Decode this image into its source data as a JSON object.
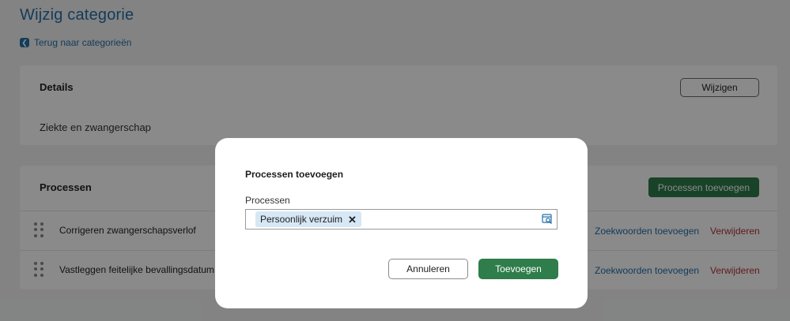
{
  "page": {
    "title": "Wijzig categorie",
    "back_link": "Terug naar categorieën"
  },
  "details": {
    "title": "Details",
    "edit_button": "Wijzigen",
    "value": "Ziekte en zwangerschap"
  },
  "processes": {
    "title": "Processen",
    "add_button": "Processen toevoegen",
    "rows": [
      {
        "label": "Corrigeren zwangerschapsverlof",
        "keywords_link": "Zoekwoorden toevoegen",
        "delete_link": "Verwijderen"
      },
      {
        "label": "Vastleggen feitelijke bevallingsdatum",
        "keywords_link": "Zoekwoorden toevoegen",
        "delete_link": "Verwijderen"
      }
    ]
  },
  "modal": {
    "title": "Processen toevoegen",
    "field_label": "Processen",
    "selected_chips": [
      "Persoonlijk verzuim"
    ],
    "cancel_button": "Annuleren",
    "submit_button": "Toevoegen"
  },
  "colors": {
    "accent_blue": "#236fa8",
    "primary_green": "#2e7d4a",
    "danger_red": "#b3303a",
    "chip_bg": "#d6e7f5"
  }
}
